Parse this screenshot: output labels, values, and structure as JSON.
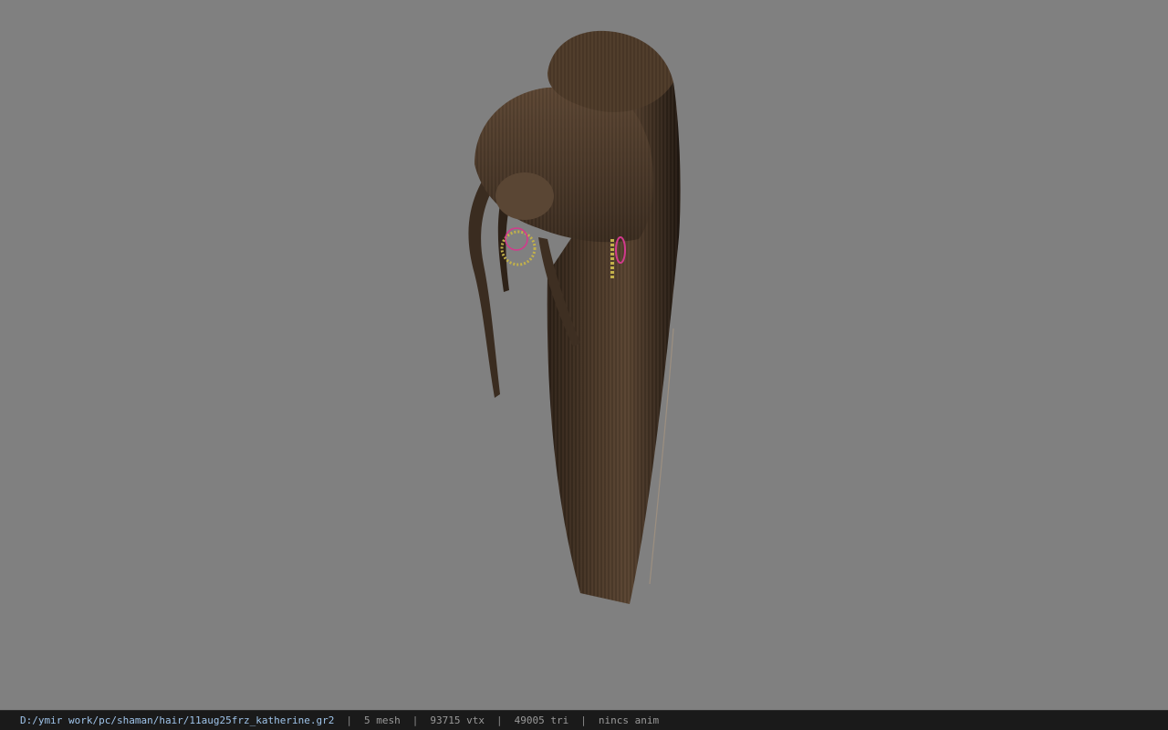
{
  "viewport": {
    "background_color": "#808080",
    "model": {
      "hair_color": "#3a2c20",
      "hair_highlight": "#6b5440",
      "earring_color": "#c2b14a",
      "ring_color": "#d23a8c"
    }
  },
  "statusbar": {
    "file_path": "D:/ymir work/pc/shaman/hair/11aug25frz_katherine.gr2",
    "separator": "|",
    "mesh_count": "5 mesh",
    "vertex_count": "93715 vtx",
    "triangle_count": "49005 tri",
    "anim_status": "nincs anim"
  }
}
